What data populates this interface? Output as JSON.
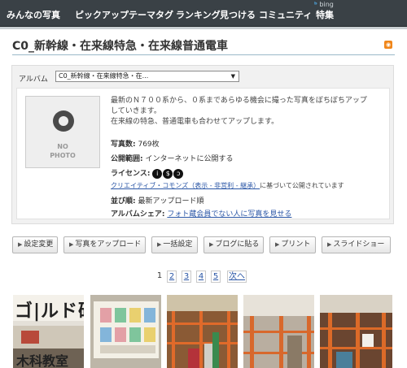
{
  "nav": {
    "items": [
      "みんなの写真",
      "ピックアップ",
      "テーマタグ",
      "ランキング",
      "見つける",
      "コミュニティ",
      "特集"
    ],
    "bing": "bing"
  },
  "page": {
    "title": "C0_新幹線・在来線特急・在来線普通電車",
    "rss_icon": "rss-icon"
  },
  "album": {
    "label": "アルバム",
    "selected": "C0_新幹線・在来線特急・在...",
    "nophoto_line1": "NO",
    "nophoto_line2": "PHOTO",
    "description_line1": "最新のＮ７００系から、０系まであらゆる機会に撮った写真をぼちぼちアップ",
    "description_line2": "していきます。",
    "description_line3": "在来線の特急、普通電車も合わせてアップします。",
    "photos_label": "写真数:",
    "photos_value": "769枚",
    "scope_label": "公開範囲:",
    "scope_value": "インターネットに公開する",
    "license_label": "ライセンス:",
    "cc_link": "クリエイティブ・コモンズ（表示 - 非営利 - 継承）",
    "cc_suffix": "に基づいて公開されています",
    "order_label": "並び順:",
    "order_value": "最新アップロード順",
    "share_label": "アルバムシェア:",
    "share_link": "フォト蔵会員でない人に写真を見せる"
  },
  "buttons": {
    "settings": "設定変更",
    "upload": "写真をアップロード",
    "bulk": "一括設定",
    "blog": "ブログに貼る",
    "print": "プリント",
    "slideshow": "スライドショー"
  },
  "pager": {
    "current": "1",
    "pages": [
      "2",
      "3",
      "4",
      "5"
    ],
    "next": "次へ"
  },
  "thumbs": {
    "t1_text": "ゴ|ルド研",
    "t1_text2": "木科教室"
  },
  "colors": {
    "nav_bg": "#3a4146",
    "link": "#2a56a6",
    "rss": "#f0861a"
  }
}
